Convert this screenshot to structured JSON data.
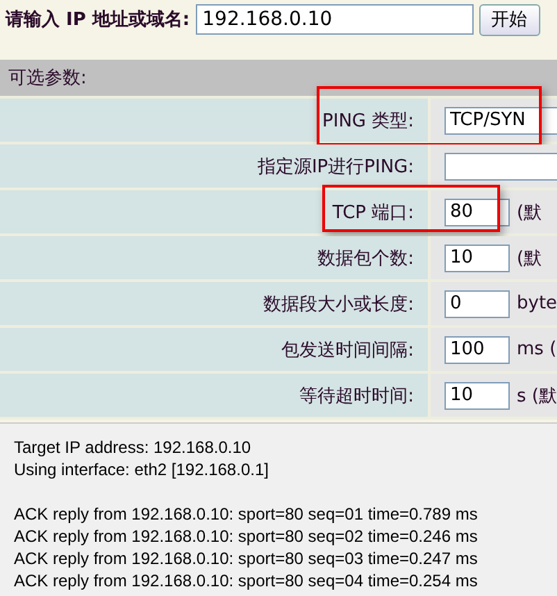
{
  "target": {
    "label": "请输入 IP 地址或域名:",
    "value": "192.168.0.10",
    "button": "开始"
  },
  "options": {
    "title": "可选参数:",
    "rows": [
      {
        "label": "PING 类型:",
        "value": "TCP/SYN",
        "kind": "wide",
        "suffix": "",
        "highlighted": true
      },
      {
        "label": "指定源IP进行PING:",
        "value": "",
        "kind": "wide",
        "suffix": "",
        "highlighted": false
      },
      {
        "label": "TCP 端口:",
        "value": "80",
        "kind": "short",
        "suffix": "(默",
        "highlighted": true
      },
      {
        "label": "数据包个数:",
        "value": "10",
        "kind": "short",
        "suffix": "(默",
        "highlighted": false
      },
      {
        "label": "数据段大小或长度:",
        "value": "0",
        "kind": "short",
        "suffix": "byte",
        "highlighted": false
      },
      {
        "label": "包发送时间间隔:",
        "value": "100",
        "kind": "short",
        "suffix": "ms (",
        "highlighted": false
      },
      {
        "label": "等待超时时间:",
        "value": "10",
        "kind": "short",
        "suffix": "s (默",
        "highlighted": false
      }
    ]
  },
  "log": {
    "header": [
      "Target IP address: 192.168.0.10",
      "Using interface: eth2 [192.168.0.1]"
    ],
    "replies": [
      "ACK reply from 192.168.0.10: sport=80 seq=01 time=0.789 ms",
      "ACK reply from 192.168.0.10: sport=80 seq=02 time=0.246 ms",
      "ACK reply from 192.168.0.10: sport=80 seq=03 time=0.247 ms",
      "ACK reply from 192.168.0.10: sport=80 seq=04 time=0.254 ms"
    ]
  }
}
